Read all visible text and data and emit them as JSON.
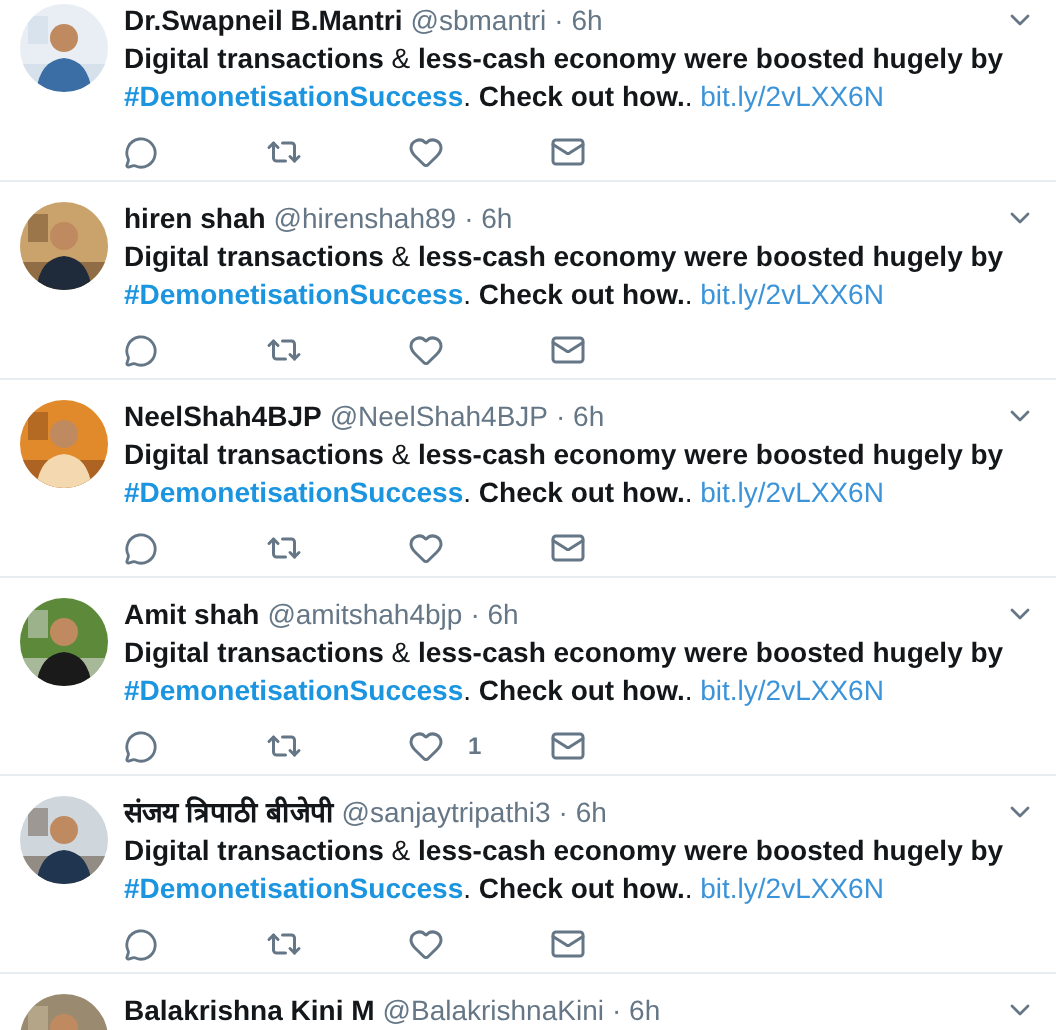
{
  "tweets": [
    {
      "name": "Dr.Swapneil B.Mantri",
      "handle": "@sbmantri",
      "time": "· 6h",
      "body": {
        "text": "**Digital transactions** & **less-cash economy were boosted hugely by**",
        "hashtag": "#DemonetisationSuccess",
        "after": ". **Check out how.**.",
        "link": "bit.ly/2vLXX6N"
      }
    },
    {
      "name": "hiren shah",
      "handle": "@hirenshah89",
      "time": "· 6h",
      "body": {
        "text": "**Digital transactions** & **less-cash economy were boosted hugely by**",
        "hashtag": "#DemonetisationSuccess",
        "after": ". **Check out how.**.",
        "link": "bit.ly/2vLXX6N"
      }
    },
    {
      "name": "NeelShah4BJP",
      "handle": "@NeelShah4BJP",
      "time": "· 6h",
      "body": {
        "text": "**Digital transactions** & **less-cash economy were boosted hugely by**",
        "hashtag": "#DemonetisationSuccess",
        "after": ". **Check out how.**.",
        "link": "bit.ly/2vLXX6N"
      }
    },
    {
      "name": "Amit shah",
      "handle": "@amitshah4bjp",
      "time": "· 6h",
      "body": {
        "text": "**Digital transactions** & **less-cash economy were boosted hugely by**",
        "hashtag": "#DemonetisationSuccess",
        "after": ". **Check out how.**.",
        "link": "bit.ly/2vLXX6N"
      },
      "likes": "1"
    },
    {
      "name": "संजय त्रिपाठी बीजेपी",
      "handle": "@sanjaytripathi3",
      "time": "· 6h",
      "body": {
        "text": "**Digital transactions** & **less-cash economy were boosted hugely by**",
        "hashtag": "#DemonetisationSuccess",
        "after": ". **Check out how.**.",
        "link": "bit.ly/2vLXX6N"
      }
    },
    {
      "name": "Balakrishna Kini M",
      "handle": "@BalakrishnaKini",
      "time": "· 6h"
    }
  ]
}
